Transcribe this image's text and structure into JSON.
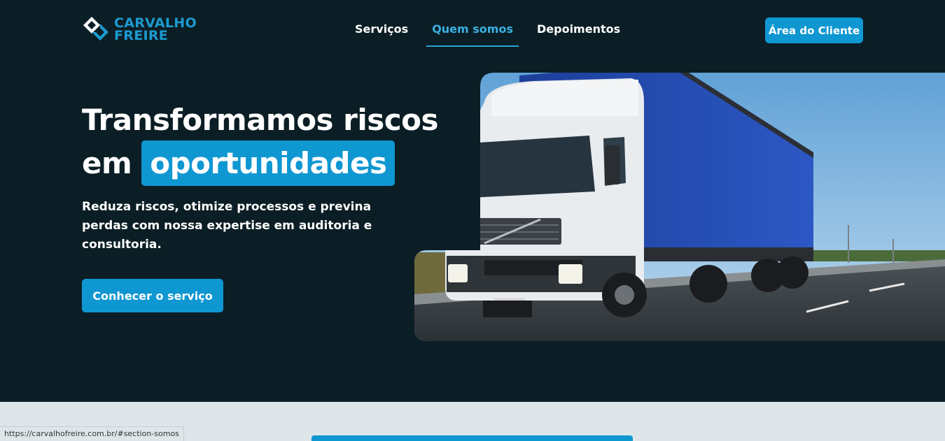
{
  "header": {
    "logo_line1": "CARVALHO",
    "logo_line2": "FREIRE",
    "nav": [
      {
        "label": "Serviços",
        "active": false
      },
      {
        "label": "Quem somos",
        "active": true
      },
      {
        "label": "Depoimentos",
        "active": false
      }
    ],
    "client_button": "Área do Cliente"
  },
  "hero": {
    "headline_line1": "Transformamos riscos",
    "headline_line2_prefix": "em",
    "headline_highlight": "oportunidades",
    "subtitle": "Reduza riscos, otimize processos e previna perdas com nossa expertise em auditoria e consultoria.",
    "cta_button": "Conhecer o serviço",
    "image_alt_icon": "truck-photo"
  },
  "status_bar": {
    "url": "https://carvalhofreire.com.br/#section-somos"
  },
  "colors": {
    "background_dark": "#0b1e25",
    "accent": "#0f97d2",
    "section_light": "#dfe6e9"
  }
}
